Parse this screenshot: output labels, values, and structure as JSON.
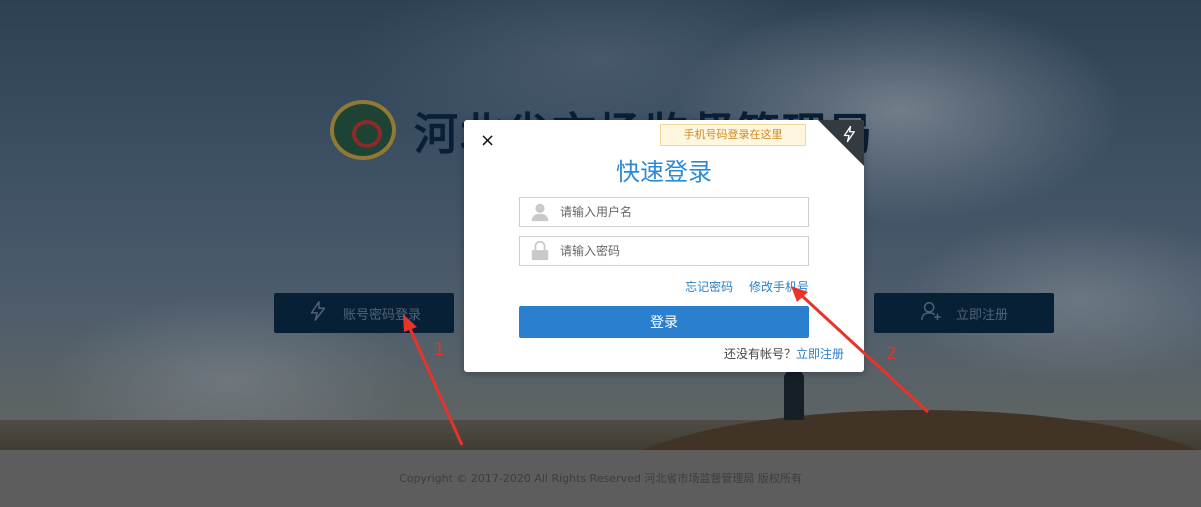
{
  "site": {
    "title": "河北省市场监督管理局"
  },
  "side_buttons": {
    "left_label": "账号密码登录",
    "right_label": "立即注册"
  },
  "modal": {
    "tip": "手机号码登录在这里",
    "close": "×",
    "title": "快速登录",
    "username_placeholder": "请输入用户名",
    "password_placeholder": "请输入密码",
    "forgot_password": "忘记密码",
    "change_phone": "修改手机号",
    "login_button": "登录",
    "no_account": "还没有帐号？",
    "register_link": "立即注册"
  },
  "annotations": {
    "label_1": "1",
    "label_2": "2",
    "color": "#e8332a"
  },
  "footer": {
    "copyright": "Copyright © 2017-2020 All Rights Reserved 河北省市场监督管理局 版权所有"
  },
  "colors": {
    "accent": "#2b7fcf",
    "title_blue": "#2b8ad8",
    "dark_navy": "#0c2d4c"
  }
}
